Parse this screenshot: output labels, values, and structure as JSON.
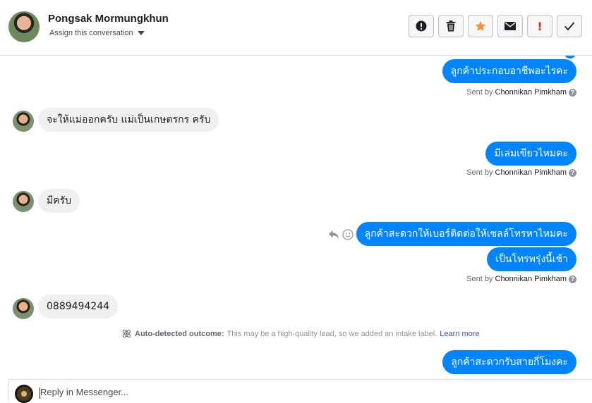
{
  "header": {
    "contact_name": "Pongsak Mormungkhun",
    "assign_label": "Assign this conversation",
    "toolbar": [
      {
        "name": "mark-spam-button",
        "icon": "alert-circle-icon"
      },
      {
        "name": "delete-button",
        "icon": "trash-icon"
      },
      {
        "name": "star-button",
        "icon": "star-icon",
        "color": "#f7923a"
      },
      {
        "name": "mark-unread-button",
        "icon": "envelope-icon"
      },
      {
        "name": "follow-up-button",
        "icon": "exclamation-icon",
        "glyph": "!",
        "color": "#e02424"
      },
      {
        "name": "mark-done-button",
        "icon": "checkmark-icon"
      }
    ]
  },
  "messages": {
    "out1": "ลูกค้าประกอบอาชีพอะไรคะ",
    "sent1_prefix": "Sent by",
    "sent1_name": "Chonnikan Pimkham",
    "in1": "จะให้แม่ออกครับ แม่เป็นเกษตรกร ครับ",
    "out2": "มีเล่มเขียวไหมคะ",
    "sent2_prefix": "Sent by",
    "sent2_name": "Chonnikan Pimkham",
    "in2": "มีครับ",
    "out3": "ลูกค้าสะดวกให้เบอร์ติดต่อให้เซลล์โทรหาไหมคะ",
    "out4": "เป็นโทรพรุ่งนี้เช้า",
    "sent3_prefix": "Sent by",
    "sent3_name": "Chonnikan Pimkham",
    "in3": "0889494244",
    "out5": "ลูกค้าสะดวกรับสายกี่โมงคะ"
  },
  "outcome": {
    "label": "Auto-detected outcome:",
    "text": "This may be a high-quality lead, so we added an intake label.",
    "link": "Learn more"
  },
  "reply": {
    "placeholder": "Reply in Messenger..."
  },
  "colors": {
    "outgoing_bubble": "#0084ff",
    "incoming_bubble": "#f1f0f0",
    "link": "#385898"
  }
}
